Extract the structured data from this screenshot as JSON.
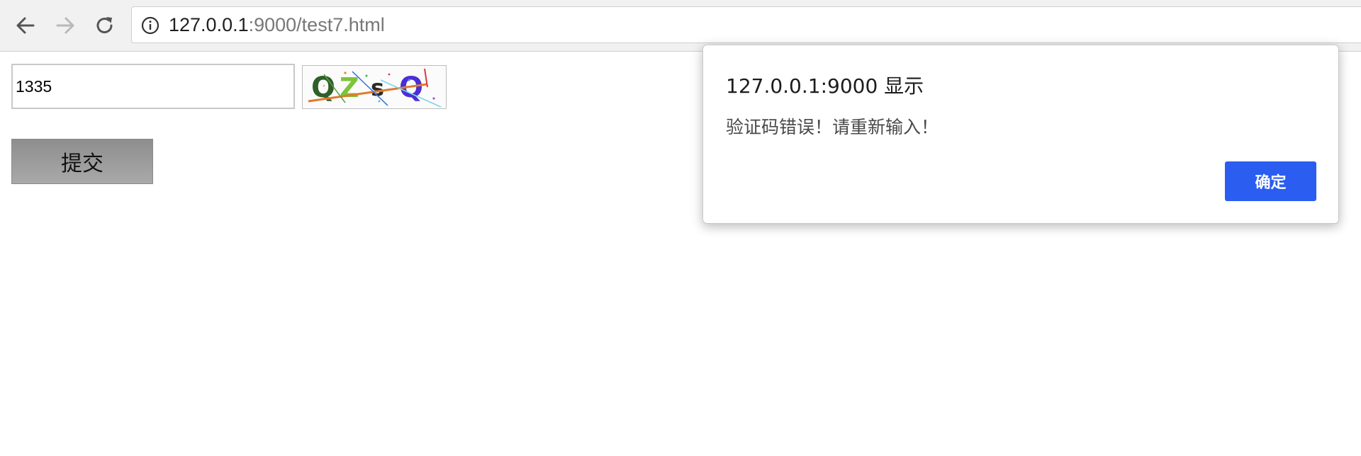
{
  "browser": {
    "url_host": "127.0.0.1",
    "url_rest": ":9000/test7.html",
    "back_icon": "arrow-left-icon",
    "forward_icon": "arrow-right-icon",
    "reload_icon": "reload-icon",
    "info_icon": "info-circle-icon"
  },
  "form": {
    "captcha_value": "1335",
    "captcha_image_text": "QZsQ",
    "submit_label": "提交"
  },
  "dialog": {
    "title": "127.0.0.1:9000 显示",
    "message": "验证码错误！请重新输入！",
    "ok_label": "确定",
    "ok_color": "#2a5df0"
  }
}
